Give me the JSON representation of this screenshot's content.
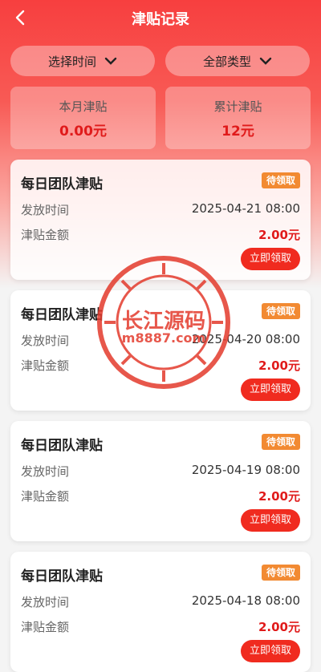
{
  "header": {
    "title": "津贴记录"
  },
  "filters": {
    "time_label": "选择时间",
    "type_label": "全部类型"
  },
  "stats": {
    "month_label": "本月津贴",
    "month_value": "0.00元",
    "total_label": "累计津贴",
    "total_value": "12元"
  },
  "records": [
    {
      "title": "每日团队津贴",
      "status": "待领取",
      "time_label": "发放时间",
      "time": "2025-04-21 08:00",
      "amount_label": "津贴金额",
      "amount": "2.00元",
      "action": "立即领取"
    },
    {
      "title": "每日团队津贴",
      "status": "待领取",
      "time_label": "发放时间",
      "time": "2025-04-20 08:00",
      "amount_label": "津贴金额",
      "amount": "2.00元",
      "action": "立即领取"
    },
    {
      "title": "每日团队津贴",
      "status": "待领取",
      "time_label": "发放时间",
      "time": "2025-04-19 08:00",
      "amount_label": "津贴金额",
      "amount": "2.00元",
      "action": "立即领取"
    },
    {
      "title": "每日团队津贴",
      "status": "待领取",
      "time_label": "发放时间",
      "time": "2025-04-18 08:00",
      "amount_label": "津贴金额",
      "amount": "2.00元",
      "action": "立即领取"
    }
  ],
  "watermark": {
    "name": "长江源码",
    "site": "m8887.com"
  },
  "icons": {
    "back": "back-arrow-icon",
    "dropdown": "chevron-down-icon"
  },
  "colors": {
    "header_red": "#f73f3f",
    "badge_orange": "#f28a32",
    "button_red": "#f02b1f",
    "amount_red": "#e01b1b"
  }
}
